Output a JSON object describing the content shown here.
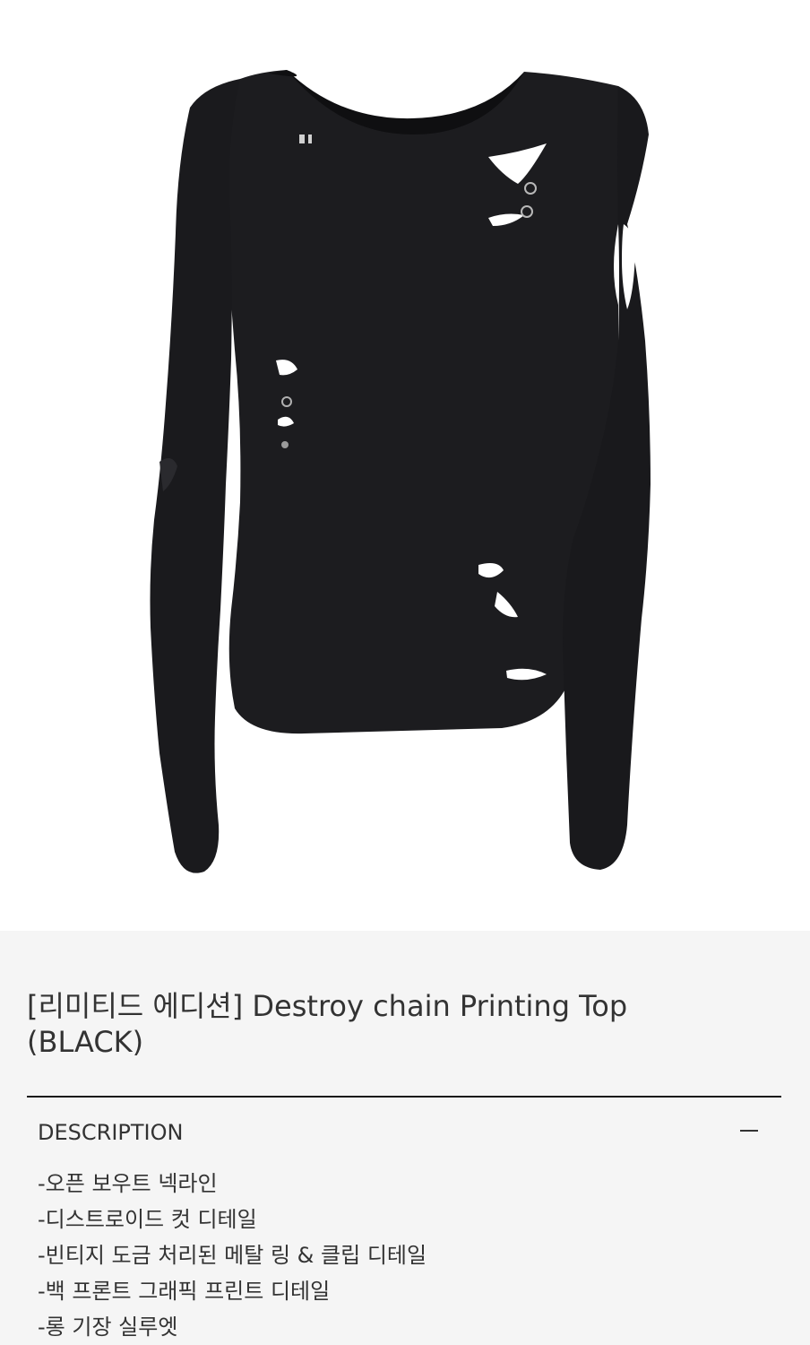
{
  "product": {
    "image_alt": "Destroy chain Printing Top black long-sleeve distressed top",
    "title_line1": "[리미티드 에디션] Destroy chain Printing Top",
    "title_line2": "(BLACK)"
  },
  "description": {
    "header": "DESCRIPTION",
    "toggle_icon": "minus-icon",
    "items": [
      "-오픈 보우트 넥라인",
      "-디스트로이드 컷 디테일",
      "-빈티지 도금 처리된 메탈 링 & 클립 디테일",
      "-백 프론트 그래픽 프린트 디테일",
      "-롱 기장 실루엣"
    ]
  },
  "colors": {
    "garment": "#1c1c1f",
    "background": "#f5f5f5",
    "image_background": "#ffffff",
    "divider": "#1a1a1a"
  }
}
